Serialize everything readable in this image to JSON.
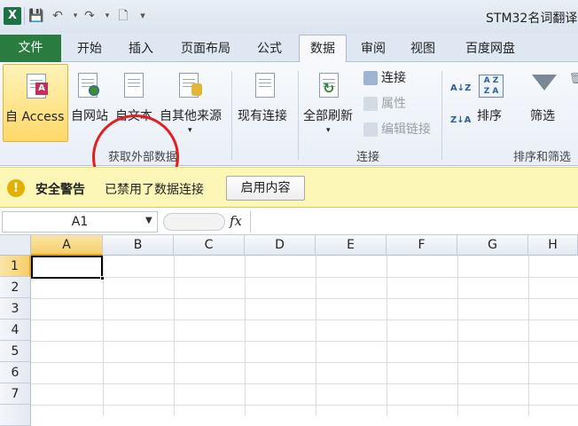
{
  "window": {
    "title": "STM32名词翻译"
  },
  "quick_access": {
    "logo": "X"
  },
  "tabs": [
    {
      "label": "文件"
    },
    {
      "label": "开始"
    },
    {
      "label": "插入"
    },
    {
      "label": "页面布局"
    },
    {
      "label": "公式"
    },
    {
      "label": "数据"
    },
    {
      "label": "审阅"
    },
    {
      "label": "视图"
    },
    {
      "label": "百度网盘"
    }
  ],
  "ribbon": {
    "get_external": {
      "group_label": "获取外部数据",
      "from_access": "自 Access",
      "from_web": "自网站",
      "from_text": "自文本",
      "from_other": "自其他来源",
      "existing": "现有连接"
    },
    "connections": {
      "group_label": "连接",
      "refresh_all": "全部刷新",
      "connections": "连接",
      "properties": "属性",
      "edit_links": "编辑链接"
    },
    "sort_filter": {
      "group_label": "排序和筛选",
      "sort": "排序",
      "filter": "筛选",
      "az": "A↓Z",
      "za": "Z↓A"
    }
  },
  "message_bar": {
    "title": "安全警告",
    "text": "已禁用了数据连接",
    "button": "启用内容"
  },
  "formula_bar": {
    "name_box": "A1",
    "fx": "fx",
    "formula": ""
  },
  "grid": {
    "columns": [
      "A",
      "B",
      "C",
      "D",
      "E",
      "F",
      "G",
      "H"
    ],
    "rows": [
      "1",
      "2",
      "3",
      "4",
      "5",
      "6",
      "7"
    ],
    "active_cell": "A1"
  }
}
